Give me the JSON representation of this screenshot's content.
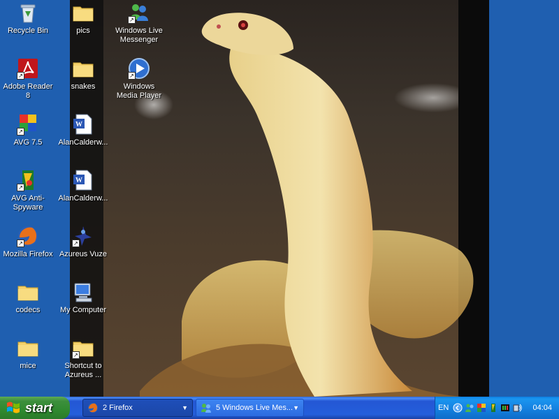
{
  "desktop": {
    "icons": [
      {
        "label": "Recycle Bin",
        "icon": "recycle-bin-icon"
      },
      {
        "label": "Adobe Reader 8",
        "icon": "adobe-reader-icon"
      },
      {
        "label": "AVG 7.5",
        "icon": "avg-icon"
      },
      {
        "label": "AVG Anti-Spyware",
        "icon": "avg-antispyware-icon"
      },
      {
        "label": "Mozilla Firefox",
        "icon": "firefox-icon"
      },
      {
        "label": "codecs",
        "icon": "folder-icon"
      },
      {
        "label": "mice",
        "icon": "folder-icon"
      },
      {
        "label": "pics",
        "icon": "folder-icon"
      },
      {
        "label": "snakes",
        "icon": "folder-icon"
      },
      {
        "label": "AlanCalderw...",
        "icon": "word-document-icon"
      },
      {
        "label": "AlanCalderw...",
        "icon": "word-document-icon"
      },
      {
        "label": "Azureus Vuze",
        "icon": "azureus-icon"
      },
      {
        "label": "My Computer",
        "icon": "my-computer-icon"
      },
      {
        "label": "Shortcut to Azureus ...",
        "icon": "folder-icon"
      },
      {
        "label": "Windows Live Messenger",
        "icon": "messenger-icon"
      },
      {
        "label": "Windows Media Player",
        "icon": "media-player-icon"
      }
    ]
  },
  "taskbar": {
    "start_label": "start",
    "tasks": [
      {
        "label": "2 Firefox",
        "icon": "firefox-icon"
      },
      {
        "label": "5 Windows Live Mes...",
        "icon": "messenger-icon"
      }
    ],
    "tray": {
      "language": "EN",
      "clock": "04:04"
    }
  },
  "colors": {
    "desktop_blue": "#1f5fb0",
    "taskbar_blue": "#245edb",
    "start_green": "#3c8f3c"
  }
}
